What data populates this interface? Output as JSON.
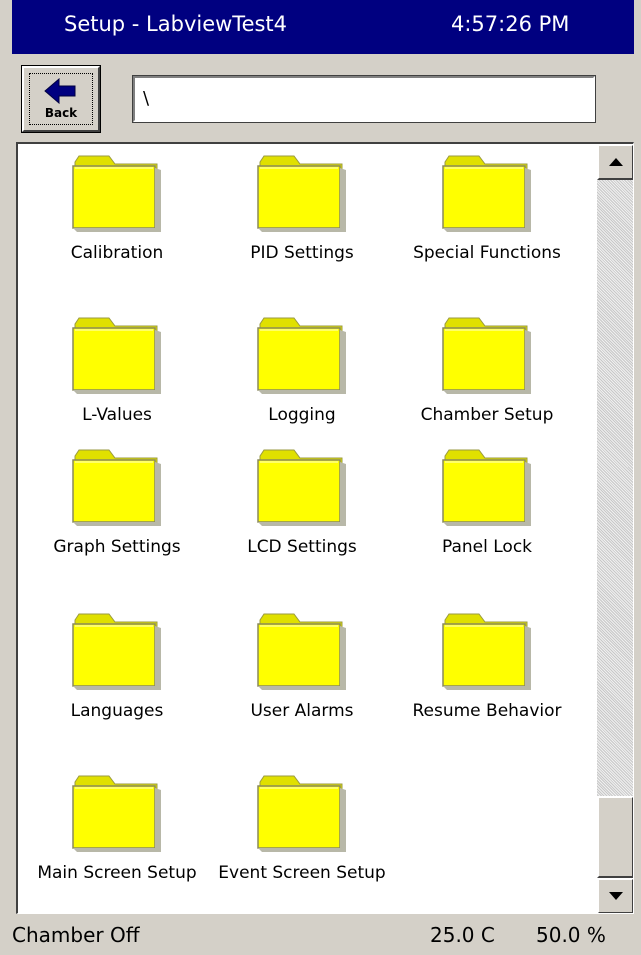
{
  "window": {
    "title": "Setup - LabviewTest4",
    "clock": "4:57:26 PM"
  },
  "toolbar": {
    "back_label": "Back",
    "path_value": "\\"
  },
  "folders": [
    {
      "label": "Calibration"
    },
    {
      "label": "PID Settings"
    },
    {
      "label": "Special Functions"
    },
    {
      "label": "L-Values"
    },
    {
      "label": "Logging"
    },
    {
      "label": "Chamber Setup"
    },
    {
      "label": "Graph Settings"
    },
    {
      "label": "LCD Settings"
    },
    {
      "label": "Panel Lock"
    },
    {
      "label": "Languages"
    },
    {
      "label": "User Alarms"
    },
    {
      "label": "Resume Behavior"
    },
    {
      "label": "Main Screen Setup"
    },
    {
      "label": "Event Screen Setup"
    }
  ],
  "status": {
    "state": "Chamber Off",
    "temperature": "25.0 C",
    "humidity": "50.0 %"
  },
  "icons": {
    "back": "back-arrow-icon",
    "folder": "folder-icon",
    "scroll_up": "scroll-up-arrow-icon",
    "scroll_down": "scroll-down-arrow-icon"
  },
  "colors": {
    "titlebar": "#000080",
    "folder_fill": "#ffff00",
    "chrome": "#d4d0c8"
  }
}
